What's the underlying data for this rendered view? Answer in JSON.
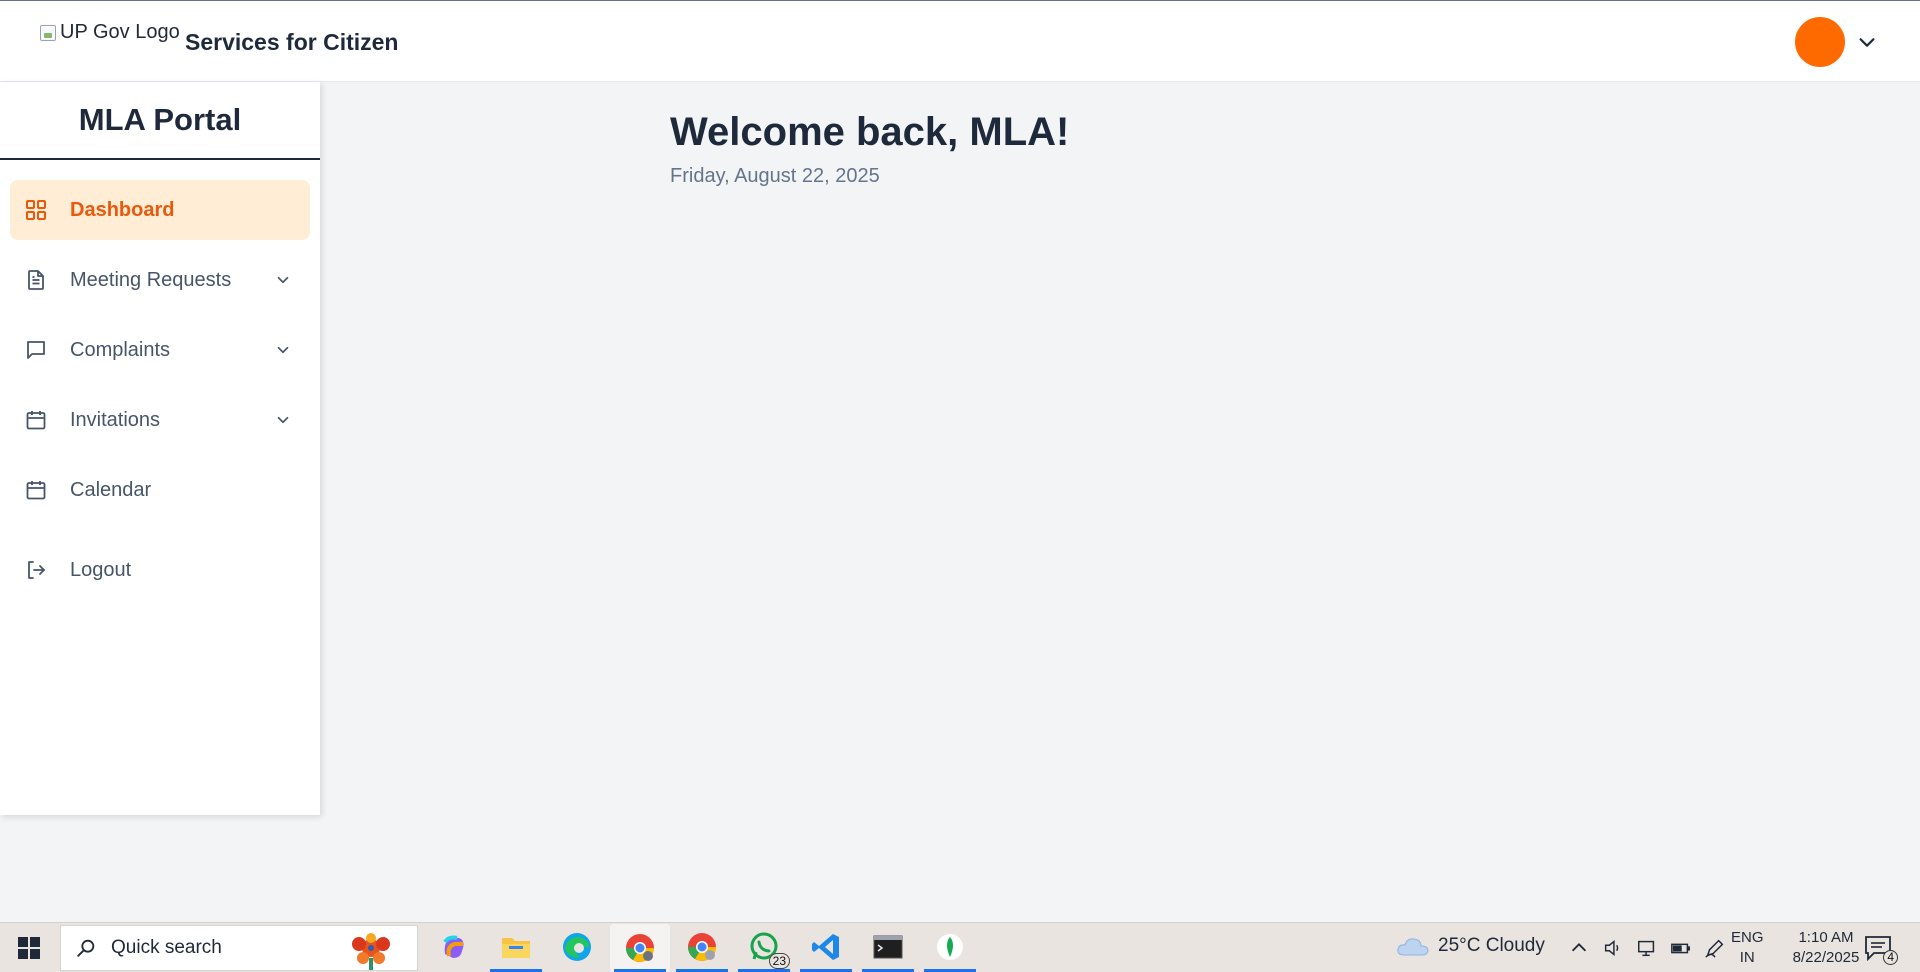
{
  "header": {
    "logo_alt": "UP Gov Logo",
    "title": "Services for Citizen",
    "avatar_color": "#ff6a00"
  },
  "sidebar": {
    "title": "MLA Portal",
    "items": [
      {
        "label": "Dashboard",
        "icon": "grid-icon",
        "active": true
      },
      {
        "label": "Meeting Requests",
        "icon": "document-icon",
        "expandable": true
      },
      {
        "label": "Complaints",
        "icon": "chat-icon",
        "expandable": true
      },
      {
        "label": "Invitations",
        "icon": "calendar-icon",
        "expandable": true
      },
      {
        "label": "Calendar",
        "icon": "calendar-icon"
      },
      {
        "label": "Logout",
        "icon": "logout-icon"
      }
    ]
  },
  "main": {
    "welcome": "Welcome back, MLA!",
    "date": "Friday, August 22, 2025"
  },
  "taskbar": {
    "search_placeholder": "Quick search",
    "whatsapp_badge": "23",
    "weather": "25°C  Cloudy",
    "lang_top": "ENG",
    "lang_bottom": "IN",
    "time": "1:10 AM",
    "date": "8/22/2025",
    "notifications": "4"
  },
  "colors": {
    "accent": "#ea580c",
    "active_bg": "#ffedd5",
    "text_dark": "#1e293b",
    "text_muted": "#64748b"
  }
}
